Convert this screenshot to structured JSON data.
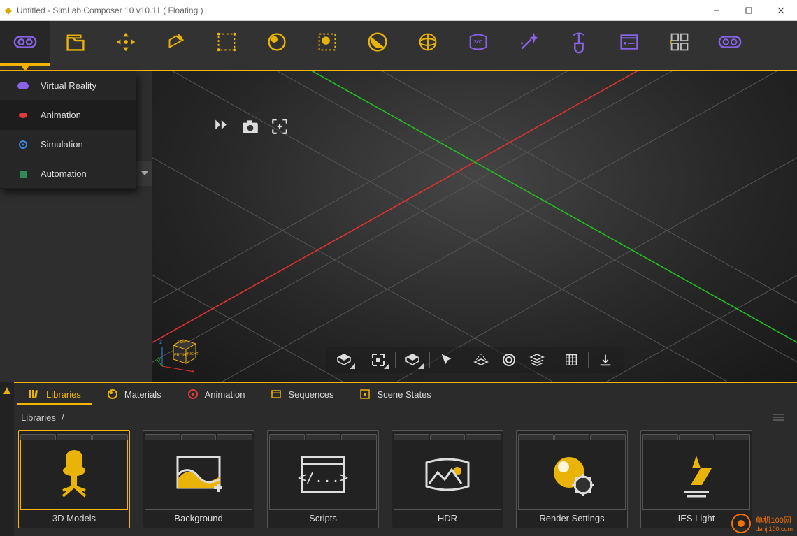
{
  "window": {
    "title": "Untitled - SimLab Composer 10 v10.11 ( Floating )"
  },
  "toolbar": {
    "items": [
      {
        "name": "mode-vr-button",
        "color": "#8863e6"
      },
      {
        "name": "file-button",
        "color": "#eab308"
      },
      {
        "name": "transform-button",
        "color": "#eab308"
      },
      {
        "name": "edit-button",
        "color": "#eab308"
      },
      {
        "name": "select-button",
        "color": "#eab308"
      },
      {
        "name": "material-button",
        "color": "#eab308"
      },
      {
        "name": "light-button",
        "color": "#eab308"
      },
      {
        "name": "texture-button",
        "color": "#eab308"
      },
      {
        "name": "environment-button",
        "color": "#eab308"
      },
      {
        "name": "panorama-button",
        "color": "#8863e6"
      },
      {
        "name": "effects-button",
        "color": "#8863e6"
      },
      {
        "name": "interaction-button",
        "color": "#8863e6"
      },
      {
        "name": "sequence-button",
        "color": "#8863e6"
      },
      {
        "name": "catalog-button",
        "color": "#bdbdbd"
      },
      {
        "name": "preview-button",
        "color": "#8863e6"
      }
    ]
  },
  "mode_menu": {
    "items": [
      {
        "label": "Virtual Reality",
        "color": "#8863e6"
      },
      {
        "label": "Animation",
        "color": "#e23a3a"
      },
      {
        "label": "Simulation",
        "color": "#3a86e2"
      },
      {
        "label": "Automation",
        "color": "#2e8b57"
      }
    ]
  },
  "viewport_top_tools": [
    {
      "name": "play-icon"
    },
    {
      "name": "camera-icon"
    },
    {
      "name": "focus-icon"
    }
  ],
  "viewport_bottom_tools": [
    {
      "name": "cube-icon",
      "hasMenu": true
    },
    {
      "name": "layers-icon",
      "hasMenu": true
    },
    {
      "name": "box-icon",
      "hasMenu": true
    },
    {
      "name": "arrow-icon"
    },
    {
      "name": "plane-icon"
    },
    {
      "name": "lens-icon"
    },
    {
      "name": "stack-icon"
    },
    {
      "name": "grid-icon"
    },
    {
      "name": "download-icon"
    }
  ],
  "viewcube": {
    "axes": [
      "x",
      "y",
      "z"
    ],
    "faces": [
      "TOP",
      "FRONT",
      "RIGHT"
    ]
  },
  "bottom_tabs": [
    {
      "label": "Libraries",
      "icon": "libraries-icon"
    },
    {
      "label": "Materials",
      "icon": "materials-icon"
    },
    {
      "label": "Animation",
      "icon": "animation-icon"
    },
    {
      "label": "Sequences",
      "icon": "sequences-icon"
    },
    {
      "label": "Scene States",
      "icon": "scenestates-icon"
    }
  ],
  "breadcrumb": {
    "root": "Libraries",
    "sep": "/"
  },
  "library_cards": [
    {
      "label": "3D Models",
      "icon": "chair"
    },
    {
      "label": "Background",
      "icon": "image"
    },
    {
      "label": "Scripts",
      "icon": "code"
    },
    {
      "label": "HDR",
      "icon": "hdr"
    },
    {
      "label": "Render Settings",
      "icon": "gear"
    },
    {
      "label": "IES Light",
      "icon": "light"
    }
  ],
  "watermark": {
    "line1": "单机100网",
    "line2": "danji100.com"
  }
}
